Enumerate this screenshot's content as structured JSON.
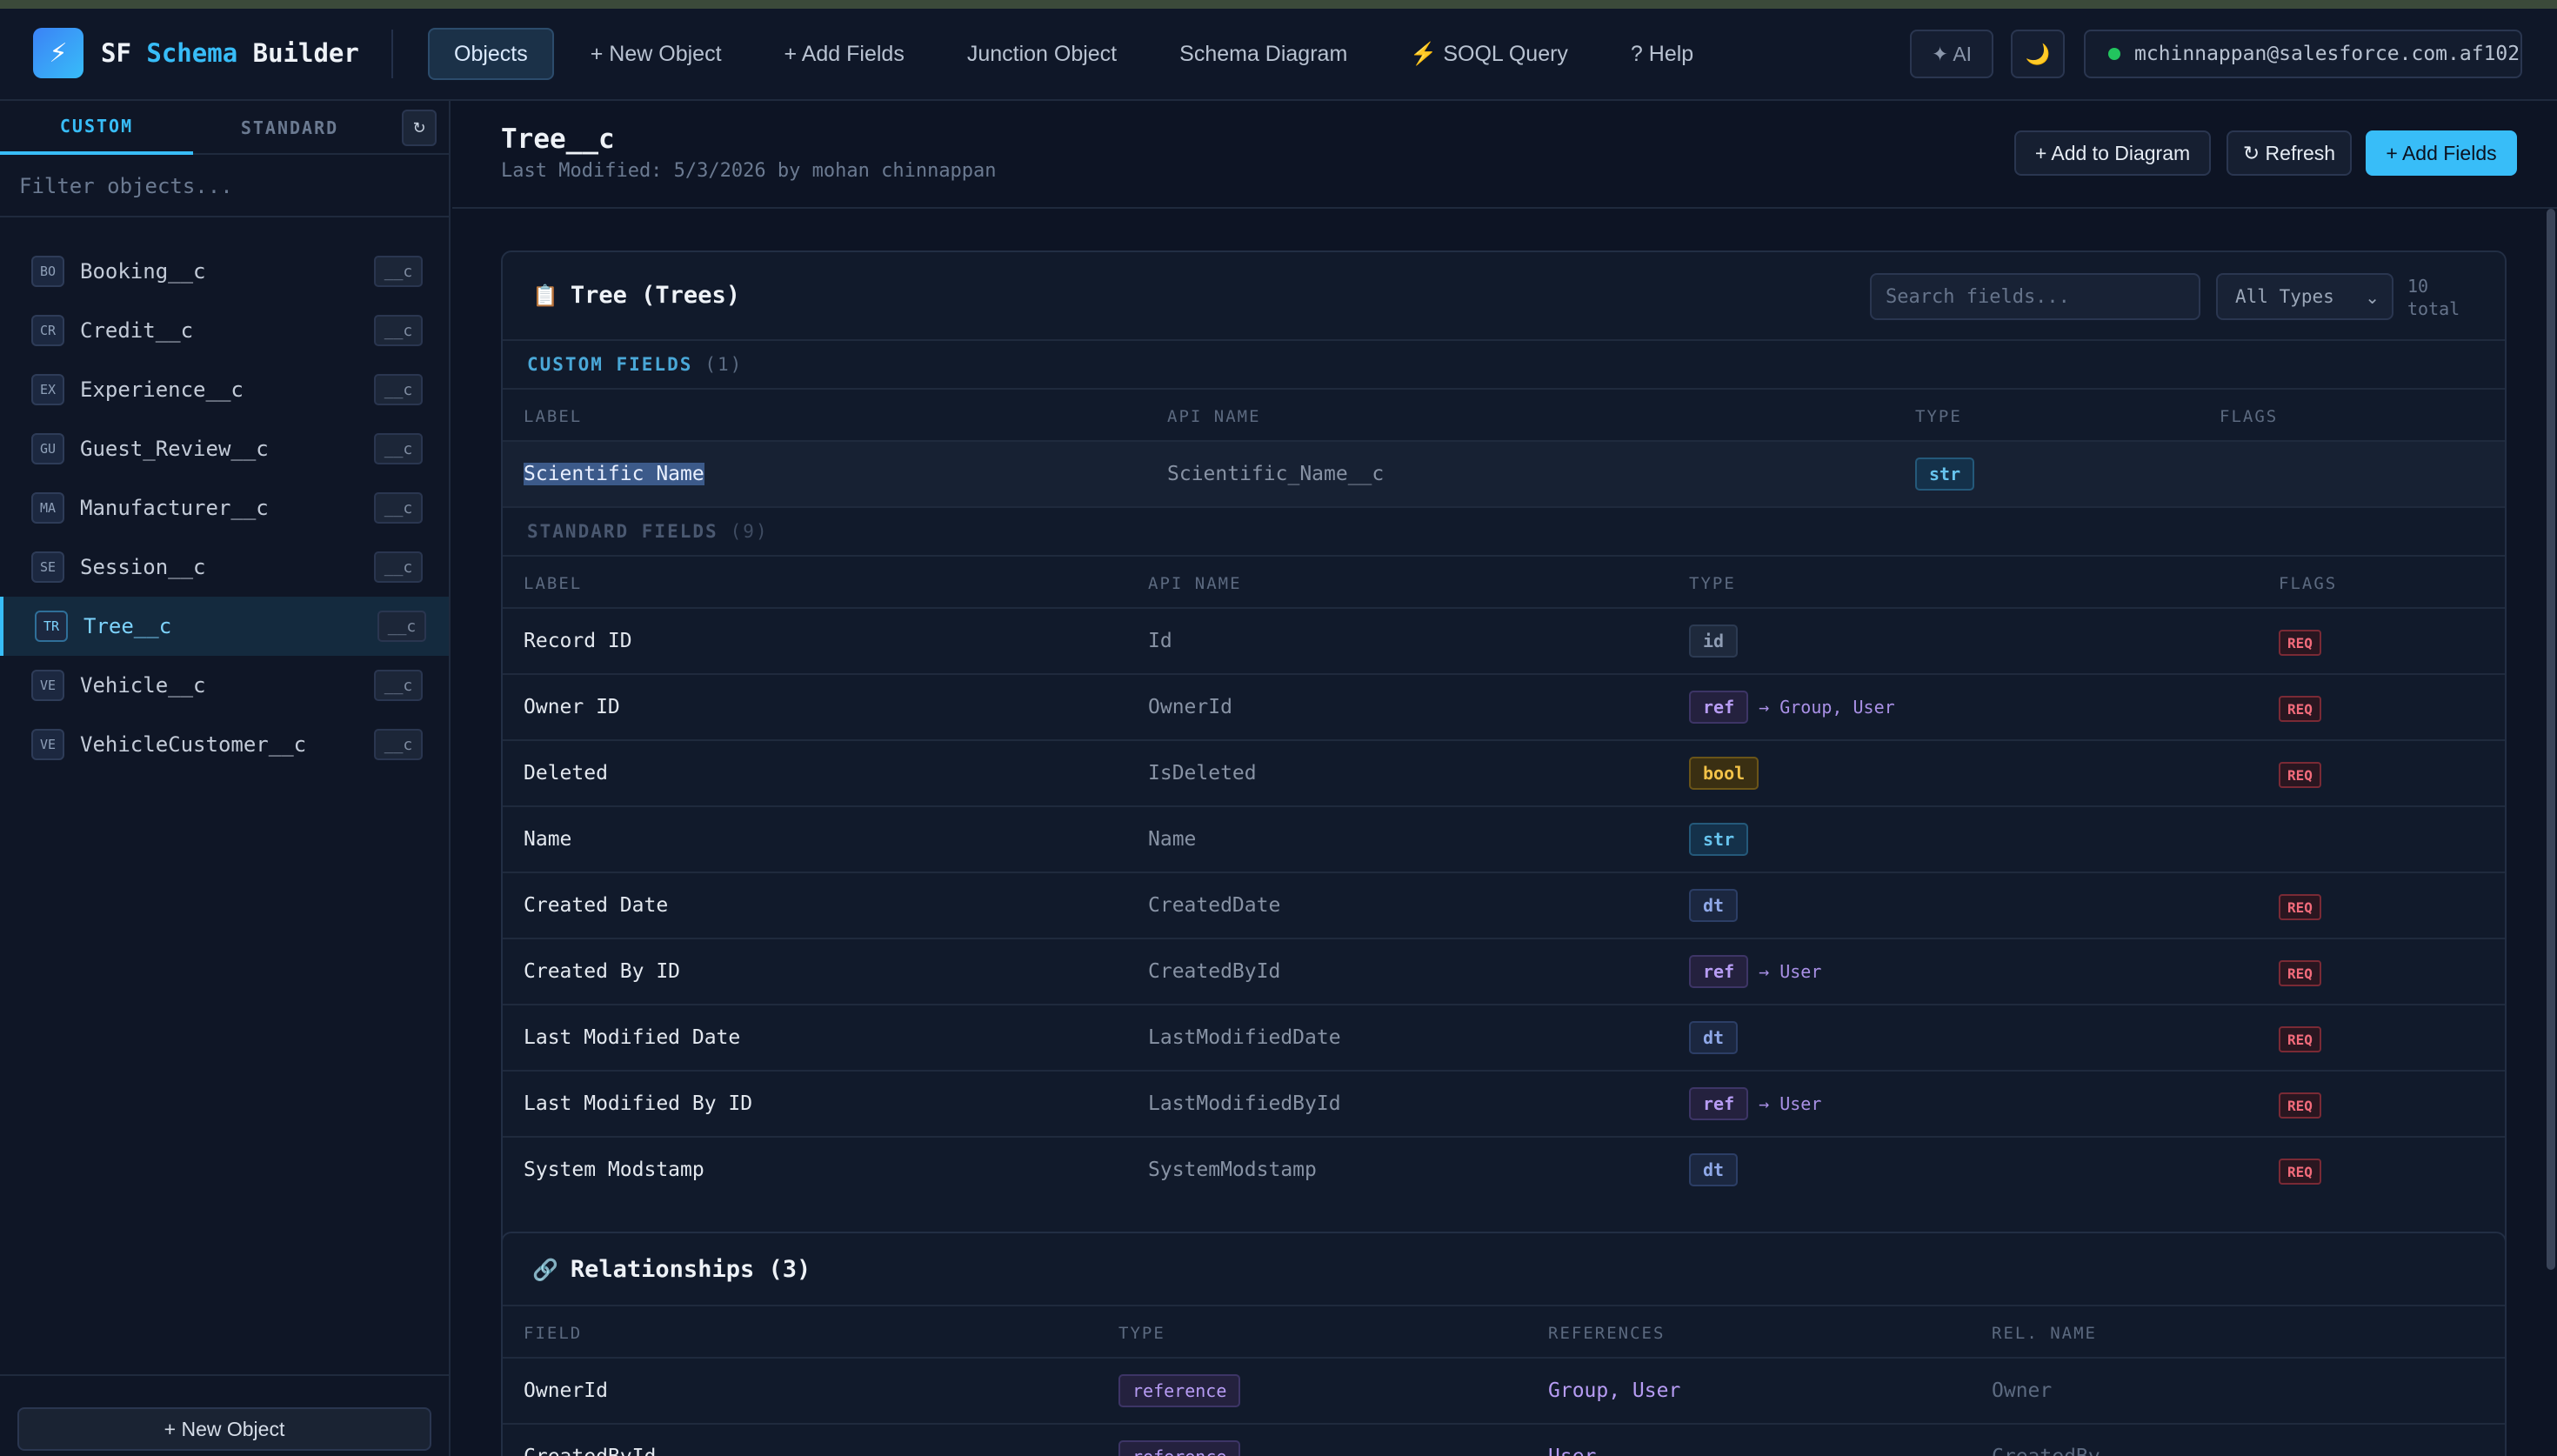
{
  "header": {
    "app_name_part1": "SF",
    "app_name_part2": "Schema",
    "app_name_part3": "Builder",
    "logo_glyph": "⚡",
    "nav": [
      {
        "label": "Objects",
        "active": true
      },
      {
        "label": "+ New Object"
      },
      {
        "label": "+ Add Fields"
      },
      {
        "label": "Junction Object"
      },
      {
        "label": "Schema Diagram"
      },
      {
        "label": "⚡ SOQL Query"
      },
      {
        "label": "? Help"
      }
    ],
    "ai_label": "✦ AI",
    "theme_glyph": "🌙",
    "user": "mchinnappan@salesforce.com.af102",
    "status_color": "#22c55e"
  },
  "sidebar": {
    "tabs": [
      "CUSTOM",
      "STANDARD"
    ],
    "active_tab": "CUSTOM",
    "refresh_glyph": "↻",
    "filter_placeholder": "Filter objects...",
    "objects": [
      {
        "abbr": "BO",
        "name": "Booking__c",
        "suffix": "__c"
      },
      {
        "abbr": "CR",
        "name": "Credit__c",
        "suffix": "__c"
      },
      {
        "abbr": "EX",
        "name": "Experience__c",
        "suffix": "__c"
      },
      {
        "abbr": "GU",
        "name": "Guest_Review__c",
        "suffix": "__c"
      },
      {
        "abbr": "MA",
        "name": "Manufacturer__c",
        "suffix": "__c"
      },
      {
        "abbr": "SE",
        "name": "Session__c",
        "suffix": "__c"
      },
      {
        "abbr": "TR",
        "name": "Tree__c",
        "suffix": "__c",
        "active": true
      },
      {
        "abbr": "VE",
        "name": "Vehicle__c",
        "suffix": "__c"
      },
      {
        "abbr": "VE",
        "name": "VehicleCustomer__c",
        "suffix": "__c"
      }
    ],
    "new_object_label": "+ New Object"
  },
  "main": {
    "object_name": "Tree__c",
    "last_modified": "Last Modified: 5/3/2026 by mohan chinnappan",
    "actions": {
      "add_to_diagram": "+ Add to Diagram",
      "refresh": "↻ Refresh",
      "add_fields": "+ Add Fields"
    },
    "fields_card": {
      "icon": "📋",
      "title": "Tree (Trees)",
      "search_placeholder": "Search fields...",
      "type_filter": "All Types",
      "total": "10 total",
      "custom_section": {
        "label": "CUSTOM FIELDS",
        "count": "(1)"
      },
      "custom_headers": [
        "LABEL",
        "API NAME",
        "TYPE",
        "FLAGS"
      ],
      "custom_rows": [
        {
          "label": "Scientific Name",
          "api": "Scientific_Name__c",
          "type": "str",
          "refs": "",
          "flag": ""
        }
      ],
      "standard_section": {
        "label": "STANDARD FIELDS",
        "count": "(9)"
      },
      "standard_headers": [
        "LABEL",
        "API NAME",
        "TYPE",
        "FLAGS"
      ],
      "standard_rows": [
        {
          "label": "Record ID",
          "api": "Id",
          "type": "id",
          "refs": "",
          "flag": "REQ"
        },
        {
          "label": "Owner ID",
          "api": "OwnerId",
          "type": "ref",
          "refs": "→ Group, User",
          "flag": "REQ"
        },
        {
          "label": "Deleted",
          "api": "IsDeleted",
          "type": "bool",
          "refs": "",
          "flag": "REQ"
        },
        {
          "label": "Name",
          "api": "Name",
          "type": "str",
          "refs": "",
          "flag": ""
        },
        {
          "label": "Created Date",
          "api": "CreatedDate",
          "type": "dt",
          "refs": "",
          "flag": "REQ"
        },
        {
          "label": "Created By ID",
          "api": "CreatedById",
          "type": "ref",
          "refs": "→ User",
          "flag": "REQ"
        },
        {
          "label": "Last Modified Date",
          "api": "LastModifiedDate",
          "type": "dt",
          "refs": "",
          "flag": "REQ"
        },
        {
          "label": "Last Modified By ID",
          "api": "LastModifiedById",
          "type": "ref",
          "refs": "→ User",
          "flag": "REQ"
        },
        {
          "label": "System Modstamp",
          "api": "SystemModstamp",
          "type": "dt",
          "refs": "",
          "flag": "REQ"
        }
      ]
    },
    "relationships_card": {
      "icon": "🔗",
      "title": "Relationships (3)",
      "headers": [
        "FIELD",
        "TYPE",
        "REFERENCES",
        "REL. NAME"
      ],
      "rows": [
        {
          "field": "OwnerId",
          "type": "reference",
          "references": "Group, User",
          "rel_name": "Owner"
        },
        {
          "field": "CreatedById",
          "type": "reference",
          "references": "User",
          "rel_name": "CreatedBy"
        }
      ]
    }
  }
}
